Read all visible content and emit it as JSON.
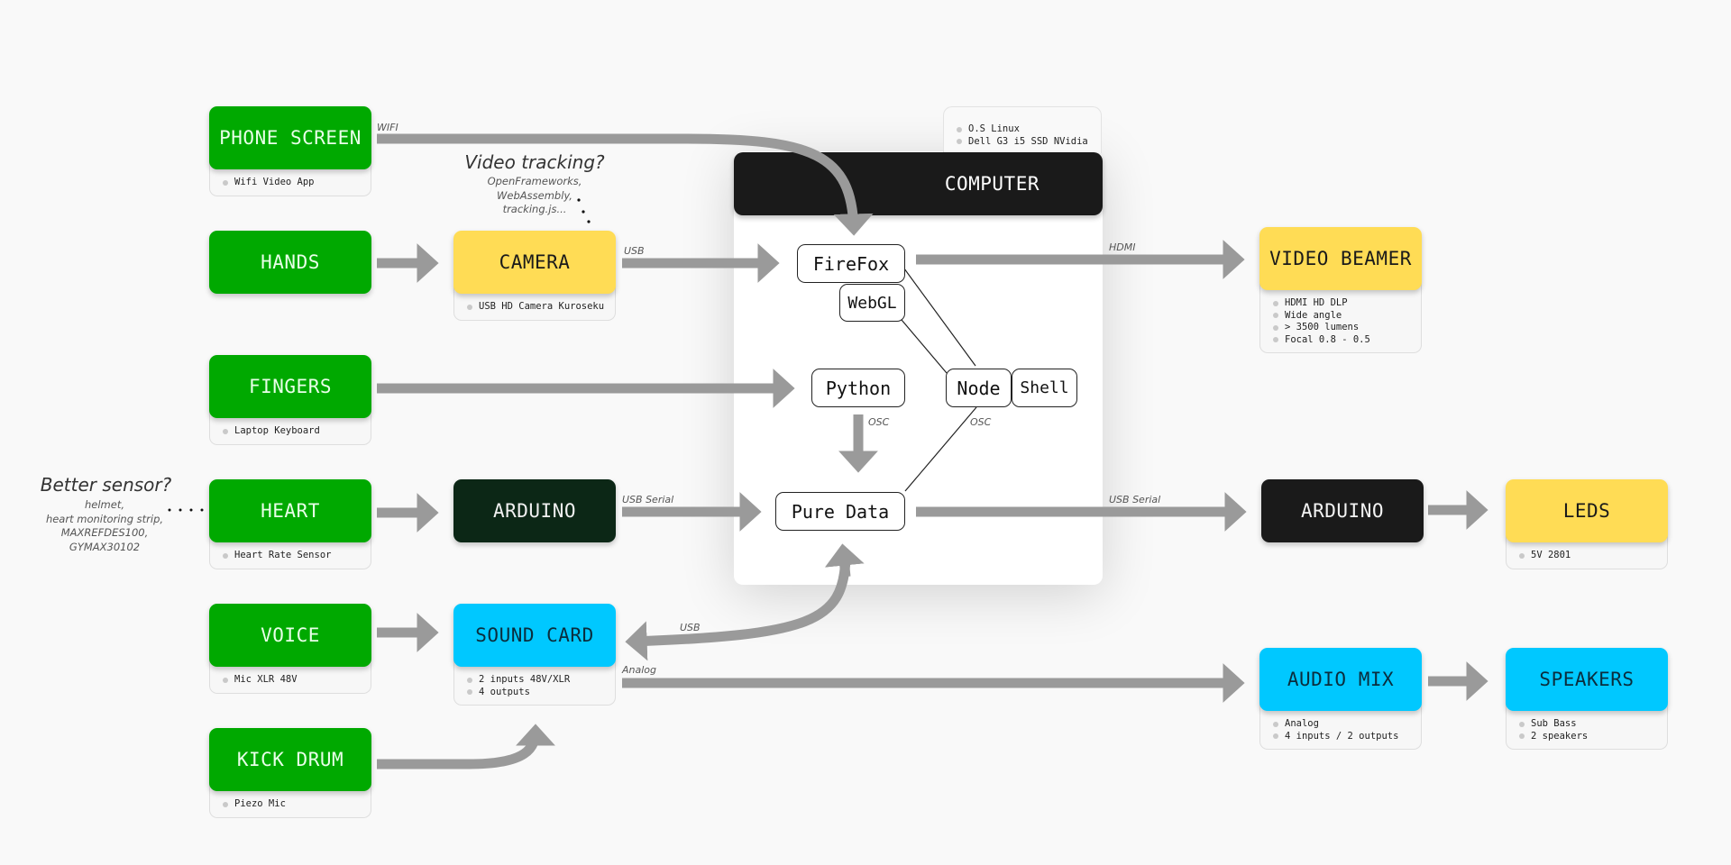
{
  "computer": {
    "title": "COMPUTER",
    "notes": [
      "O.S Linux",
      "Dell G3 i5 SSD NVidia"
    ],
    "software": {
      "firefox": "FireFox",
      "webgl": "WebGL",
      "python": "Python",
      "node": "Node",
      "shell": "Shell",
      "puredata": "Pure Data"
    }
  },
  "nodes": {
    "phone_screen": {
      "label": "PHONE SCREEN",
      "notes": [
        "Wifi Video App"
      ]
    },
    "hands": {
      "label": "HANDS",
      "notes": []
    },
    "camera": {
      "label": "CAMERA",
      "notes": [
        "USB HD Camera Kuroseku"
      ]
    },
    "fingers": {
      "label": "FINGERS",
      "notes": [
        "Laptop Keyboard"
      ]
    },
    "heart": {
      "label": "HEART",
      "notes": [
        "Heart Rate Sensor"
      ]
    },
    "arduino_in": {
      "label": "ARDUINO",
      "notes": []
    },
    "voice": {
      "label": "VOICE",
      "notes": [
        "Mic XLR 48V"
      ]
    },
    "sound_card": {
      "label": "SOUND CARD",
      "notes": [
        "2 inputs 48V/XLR",
        "4 outputs"
      ]
    },
    "kick_drum": {
      "label": "KICK DRUM",
      "notes": [
        "Piezo Mic"
      ]
    },
    "video_beamer": {
      "label": "VIDEO BEAMER",
      "notes": [
        "HDMI HD DLP",
        "Wide angle",
        "> 3500 lumens",
        "Focal 0.8 - 0.5"
      ]
    },
    "arduino_out": {
      "label": "ARDUINO",
      "notes": []
    },
    "leds": {
      "label": "LEDS",
      "notes": [
        "5V 2801"
      ]
    },
    "audio_mix": {
      "label": "AUDIO MIX",
      "notes": [
        "Analog",
        "4 inputs / 2 outputs"
      ]
    },
    "speakers": {
      "label": "SPEAKERS",
      "notes": [
        "Sub Bass",
        "2 speakers"
      ]
    }
  },
  "connections": {
    "wifi": "WIFI",
    "usb_camera": "USB",
    "hdmi": "HDMI",
    "osc_python": "OSC",
    "osc_node": "OSC",
    "usb_serial_in": "USB Serial",
    "usb_serial_out": "USB Serial",
    "usb_sound": "USB",
    "analog": "Analog"
  },
  "annotations": {
    "video_tracking": {
      "title": "Video tracking?",
      "body": [
        "OpenFrameworks,",
        "WebAssembly,",
        "tracking.js..."
      ]
    },
    "better_sensor": {
      "title": "Better sensor?",
      "body": [
        "helmet,",
        "heart monitoring strip,",
        "MAXREFDES100,",
        "GYMAX30102"
      ]
    }
  },
  "colors": {
    "input_green": "#00a900",
    "yellow": "#ffdc55",
    "cyan": "#00c8ff",
    "dark_green": "#0c2716",
    "black": "#1a1a1a",
    "arrow_gray": "#9a9a9a"
  }
}
